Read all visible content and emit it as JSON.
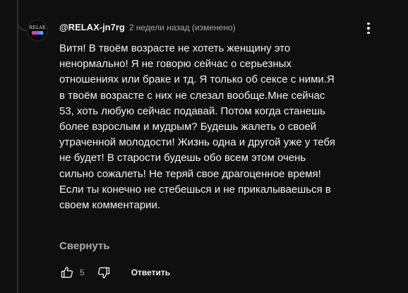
{
  "comment": {
    "avatar": {
      "icon": "relax-channel-logo",
      "logo_text": "RELAX"
    },
    "author": "@RELAX-jn7rg",
    "timestamp": "2 недели назад (изменено)",
    "text_lines": [
      "Витя! В твоём возрасте не хотеть женщину это",
      "ненормально! Я не говорю сейчас о серьезных",
      "отношениях или браке и тд. Я только об сексе с ними.Я",
      "в твоём возрасте с них не слезал вообще.Мне сейчас",
      "53, хоть любую сейчас подавай. Потом когда станешь",
      "более взрослым и мудрым? Будешь жалеть о своей",
      "утраченной молодости! Жизнь одна и другой уже у тебя",
      "не будет! В старости будешь обо всем этом очень",
      "сильно сожалеть! Не теряй свое драгоценное время!",
      "Если ты конечно не стебешься и не прикалываешься в",
      "своем комментарии."
    ],
    "collapse_label": "Свернуть",
    "like_count": "5",
    "reply_label": "Ответить",
    "icons": {
      "menu": "more-vertical-icon",
      "like": "thumbs-up-icon",
      "dislike": "thumbs-down-icon"
    }
  }
}
